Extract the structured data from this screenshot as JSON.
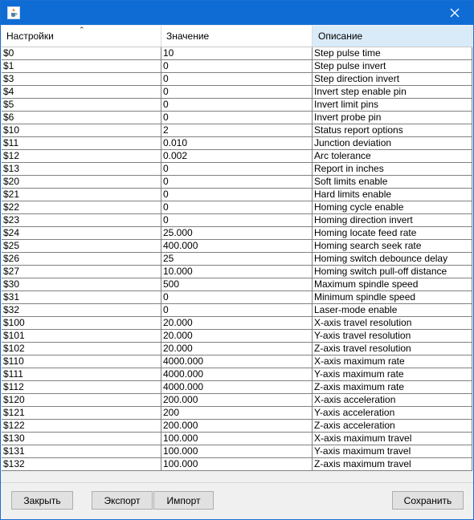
{
  "window": {
    "app_icon": "java-coffee-cup-icon",
    "close_icon": "close-icon"
  },
  "table": {
    "columns": [
      "Настройки",
      "Значение",
      "Описание"
    ],
    "rows": [
      [
        "$0",
        "10",
        "Step pulse time"
      ],
      [
        "$1",
        "0",
        "Step pulse invert"
      ],
      [
        "$3",
        "0",
        "Step direction invert"
      ],
      [
        "$4",
        "0",
        "Invert step enable pin"
      ],
      [
        "$5",
        "0",
        "Invert limit pins"
      ],
      [
        "$6",
        "0",
        "Invert probe pin"
      ],
      [
        "$10",
        "2",
        "Status report options"
      ],
      [
        "$11",
        "0.010",
        "Junction deviation"
      ],
      [
        "$12",
        "0.002",
        "Arc tolerance"
      ],
      [
        "$13",
        "0",
        "Report in inches"
      ],
      [
        "$20",
        "0",
        "Soft limits enable"
      ],
      [
        "$21",
        "0",
        "Hard limits enable"
      ],
      [
        "$22",
        "0",
        "Homing cycle enable"
      ],
      [
        "$23",
        "0",
        "Homing direction invert"
      ],
      [
        "$24",
        "25.000",
        "Homing locate feed rate"
      ],
      [
        "$25",
        "400.000",
        "Homing search seek rate"
      ],
      [
        "$26",
        "25",
        "Homing switch debounce delay"
      ],
      [
        "$27",
        "10.000",
        "Homing switch pull-off distance"
      ],
      [
        "$30",
        "500",
        "Maximum spindle speed"
      ],
      [
        "$31",
        "0",
        "Minimum spindle speed"
      ],
      [
        "$32",
        "0",
        "Laser-mode enable"
      ],
      [
        "$100",
        "20.000",
        "X-axis travel resolution"
      ],
      [
        "$101",
        "20.000",
        "Y-axis travel resolution"
      ],
      [
        "$102",
        "20.000",
        "Z-axis travel resolution"
      ],
      [
        "$110",
        "4000.000",
        "X-axis maximum rate"
      ],
      [
        "$111",
        "4000.000",
        "Y-axis maximum rate"
      ],
      [
        "$112",
        "4000.000",
        "Z-axis maximum rate"
      ],
      [
        "$120",
        "200.000",
        "X-axis acceleration"
      ],
      [
        "$121",
        "200",
        "Y-axis acceleration"
      ],
      [
        "$122",
        "200.000",
        "Z-axis acceleration"
      ],
      [
        "$130",
        "100.000",
        "X-axis maximum travel"
      ],
      [
        "$131",
        "100.000",
        "Y-axis maximum travel"
      ],
      [
        "$132",
        "100.000",
        "Z-axis maximum travel"
      ]
    ]
  },
  "buttons": {
    "close": "Закрыть",
    "export": "Экспорт",
    "import": "Импорт",
    "save": "Сохранить"
  },
  "colors": {
    "titlebar": "#0f6cd4",
    "selected_header": "#d9ebf9",
    "grid": "#808080"
  }
}
